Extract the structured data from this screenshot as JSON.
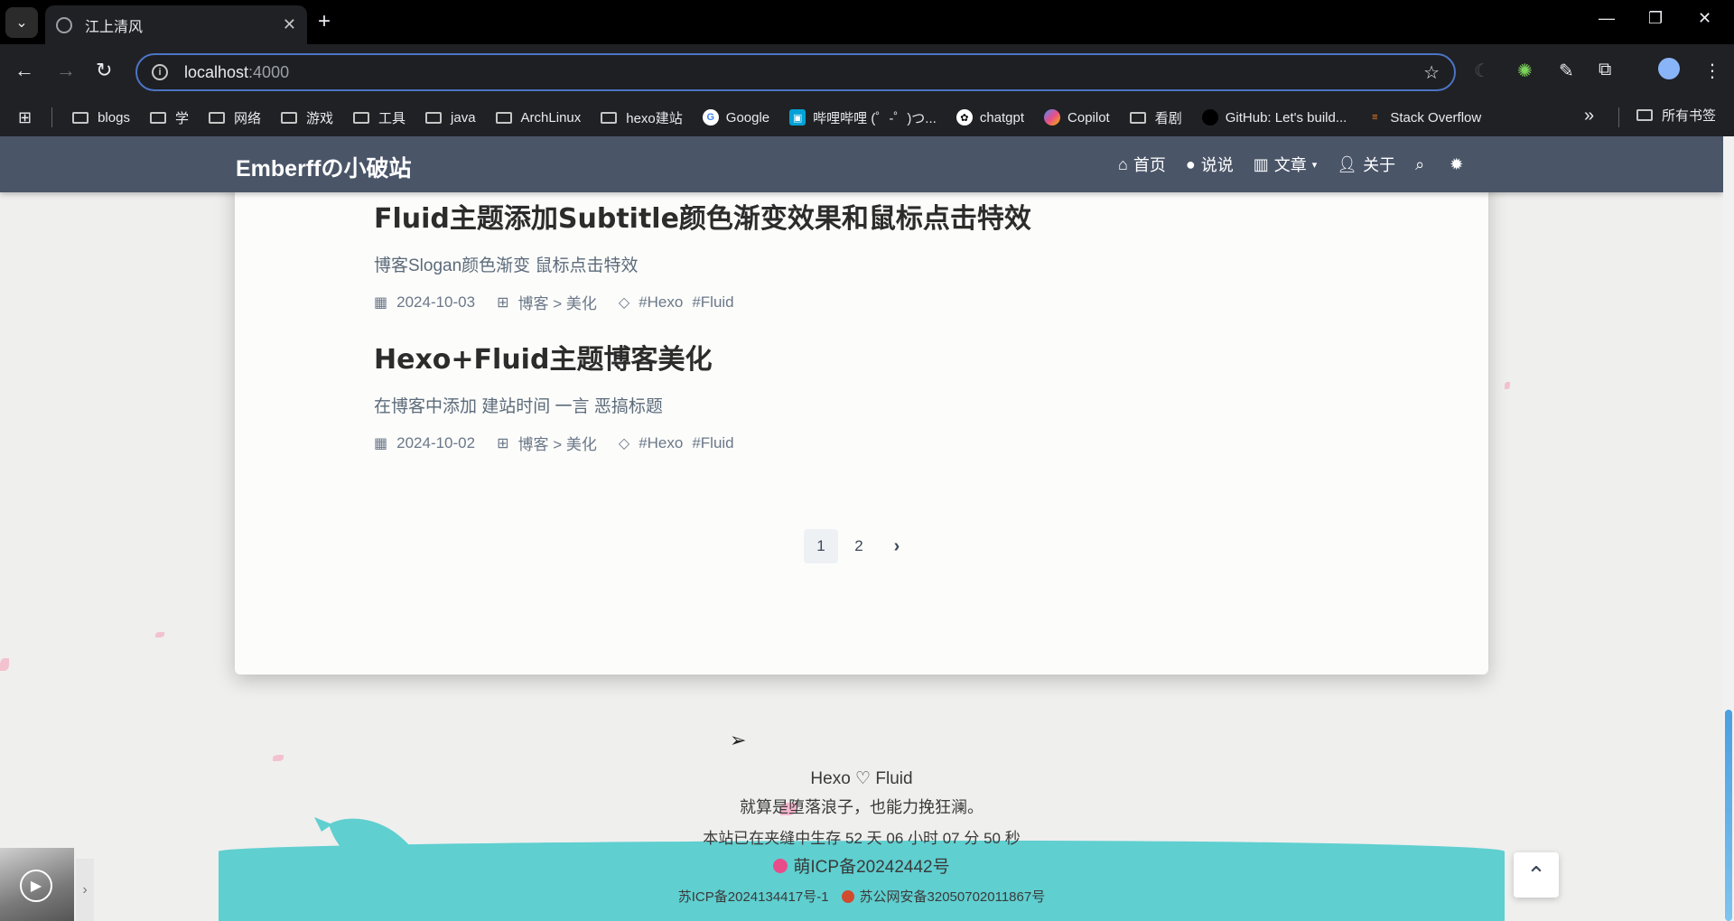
{
  "browser": {
    "tab_title": "江上清风",
    "url_host": "localhost",
    "url_port": ":4000",
    "bookmarks": [
      "blogs",
      "学",
      "网络",
      "游戏",
      "工具",
      "java",
      "ArchLinux",
      "hexo建站",
      "Google",
      "哔哩哔哩 (゜-゜)つ...",
      "chatgpt",
      "Copilot",
      "看剧",
      "GitHub: Let's build...",
      "Stack Overflow"
    ],
    "all_bookmarks": "所有书签"
  },
  "site": {
    "brand": "Emberffの小破站",
    "nav": [
      "首页",
      "说说",
      "文章",
      "关于"
    ]
  },
  "posts": [
    {
      "title": "Fluid主题添加Subtitle颜色渐变效果和鼠标点击特效",
      "excerpt": "博客Slogan颜色渐变 鼠标点击特效",
      "date": "2024-10-03",
      "category": "博客 > 美化",
      "tags": [
        "#Hexo",
        "#Fluid"
      ]
    },
    {
      "title": "Hexo+Fluid主题博客美化",
      "excerpt": "在博客中添加 建站时间 一言 恶搞标题",
      "date": "2024-10-02",
      "category": "博客 > 美化",
      "tags": [
        "#Hexo",
        "#Fluid"
      ]
    }
  ],
  "pagination": {
    "pages": [
      "1",
      "2"
    ],
    "next": "›",
    "current": "1"
  },
  "footer": {
    "powered": "Hexo ♡ Fluid",
    "motto": "就算是堕落浪子，也能力挽狂澜。",
    "uptime": "本站已在夹缝中生存 52 天 06 小时 07 分 50 秒",
    "moe_icp": "萌ICP备20242442号",
    "icp": "苏ICP备2024134417号-1",
    "police": "苏公网安备32050702011867号"
  }
}
